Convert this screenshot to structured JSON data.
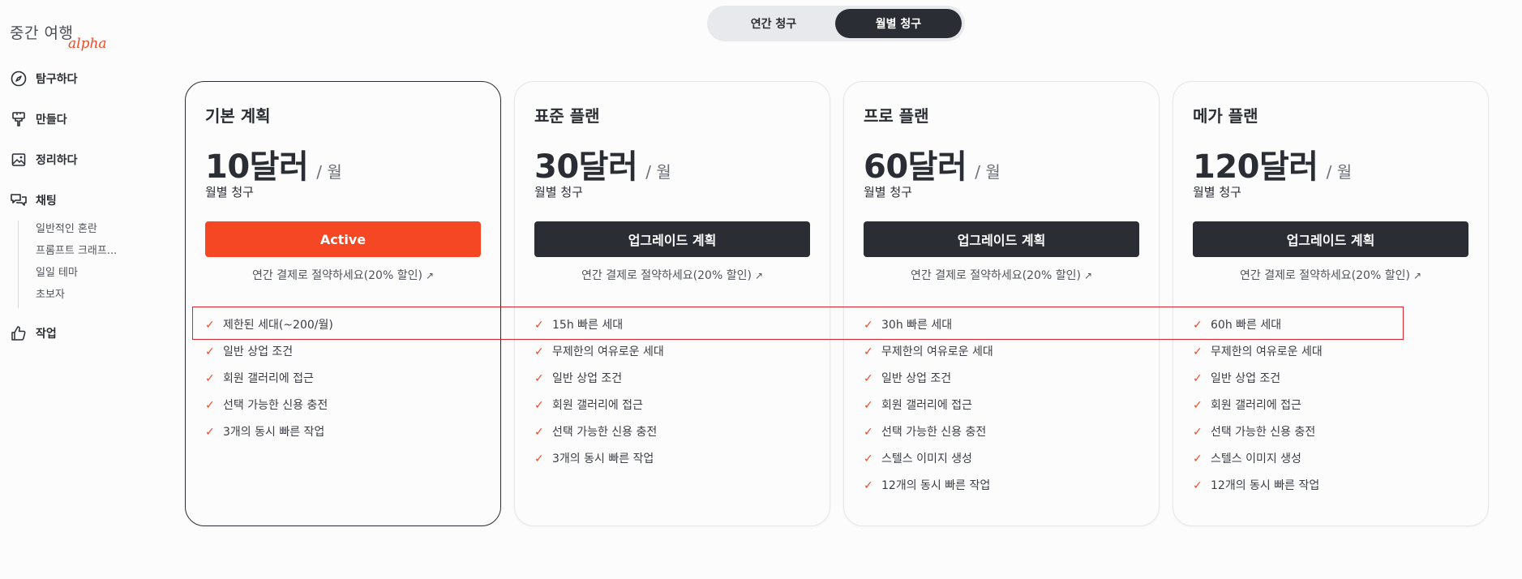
{
  "app": {
    "logo_text": "중간 여행",
    "logo_badge": "alpha"
  },
  "sidebar": {
    "items": [
      {
        "label": "탐구하다",
        "icon": "compass-icon"
      },
      {
        "label": "만들다",
        "icon": "paintbrush-icon"
      },
      {
        "label": "정리하다",
        "icon": "image-icon"
      },
      {
        "label": "채팅",
        "icon": "chat-bubbles-icon"
      },
      {
        "label": "작업",
        "icon": "thumbs-up-icon"
      }
    ],
    "chat_rooms": [
      "일반적인 혼란",
      "프롬프트 크래프...",
      "일일 테마",
      "초보자"
    ]
  },
  "billing_toggle": {
    "yearly": "연간 청구",
    "monthly": "월별 청구",
    "selected": "monthly"
  },
  "plans": [
    {
      "name": "기본 계획",
      "price": "10달러",
      "per": "/ 월",
      "billing": "월별 청구",
      "cta": "Active",
      "save": "연간 결제로 절약하세요(20% 할인)",
      "features": [
        "제한된 세대(~200/월)",
        "일반 상업 조건",
        "회원 갤러리에 접근",
        "선택 가능한 신용 충전",
        "3개의 동시 빠른 작업"
      ]
    },
    {
      "name": "표준 플랜",
      "price": "30달러",
      "per": "/ 월",
      "billing": "월별 청구",
      "cta": "업그레이드 계획",
      "save": "연간 결제로 절약하세요(20% 할인)",
      "features": [
        "15h 빠른 세대",
        "무제한의 여유로운 세대",
        "일반 상업 조건",
        "회원 갤러리에 접근",
        "선택 가능한 신용 충전",
        "3개의 동시 빠른 작업"
      ]
    },
    {
      "name": "프로 플랜",
      "price": "60달러",
      "per": "/ 월",
      "billing": "월별 청구",
      "cta": "업그레이드 계획",
      "save": "연간 결제로 절약하세요(20% 할인)",
      "features": [
        "30h 빠른 세대",
        "무제한의 여유로운 세대",
        "일반 상업 조건",
        "회원 갤러리에 접근",
        "선택 가능한 신용 충전",
        "스텔스 이미지 생성",
        "12개의 동시 빠른 작업"
      ]
    },
    {
      "name": "메가 플랜",
      "price": "120달러",
      "per": "/ 월",
      "billing": "월별 청구",
      "cta": "업그레이드 계획",
      "save": "연간 결제로 절약하세요(20% 할인)",
      "features": [
        "60h 빠른 세대",
        "무제한의 여유로운 세대",
        "일반 상업 조건",
        "회원 갤러리에 접근",
        "선택 가능한 신용 충전",
        "스텔스 이미지 생성",
        "12개의 동시 빠른 작업"
      ]
    }
  ],
  "colors": {
    "accent": "#f24a25",
    "dark": "#2a2d33",
    "highlight": "#e0232b"
  }
}
